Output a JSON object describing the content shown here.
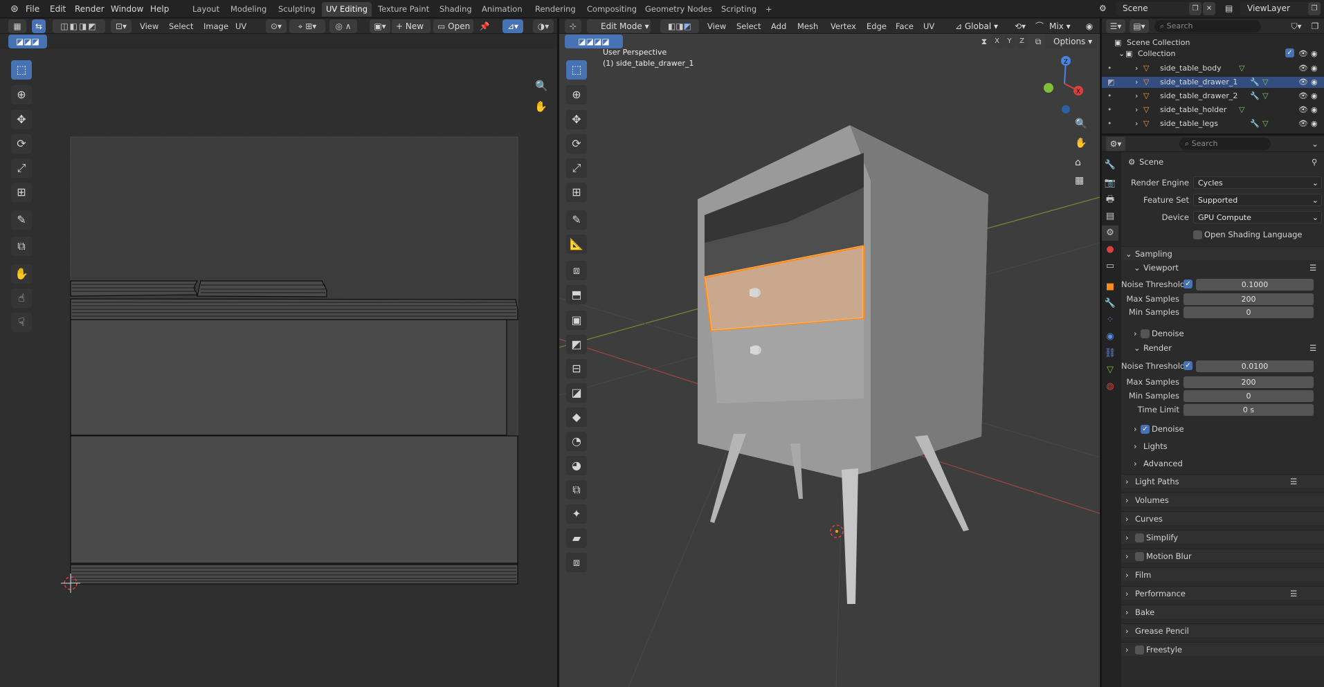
{
  "menu": {
    "file": "File",
    "edit": "Edit",
    "render": "Render",
    "window": "Window",
    "help": "Help",
    "workspaces": [
      {
        "label": "Layout"
      },
      {
        "label": "Modeling"
      },
      {
        "label": "Sculpting"
      },
      {
        "label": "UV Editing",
        "active": true
      },
      {
        "label": "Texture Paint"
      },
      {
        "label": "Shading"
      },
      {
        "label": "Animation"
      },
      {
        "label": "Rendering"
      },
      {
        "label": "Compositing"
      },
      {
        "label": "Geometry Nodes"
      },
      {
        "label": "Scripting"
      }
    ],
    "add_workspace": "+",
    "scene_name": "Scene",
    "view_layer": "ViewLayer"
  },
  "uv_editor": {
    "menus": {
      "view": "View",
      "select": "Select",
      "image": "Image",
      "uv": "UV"
    },
    "new_label": "New",
    "open_label": "Open"
  },
  "viewport": {
    "mode": "Edit Mode",
    "menus": {
      "view": "View",
      "select": "Select",
      "add": "Add",
      "mesh": "Mesh",
      "vertex": "Vertex",
      "edge": "Edge",
      "face": "Face",
      "uv": "UV"
    },
    "orientation": "Global",
    "proportional": "Mix",
    "axis_x": "X",
    "axis_y": "Y",
    "axis_z": "Z",
    "options_label": "Options",
    "overlay_title": "User Perspective",
    "overlay_object": "(1) side_table_drawer_1",
    "gizmo": {
      "x": "X",
      "y": "Y",
      "z": "Z"
    }
  },
  "outliner": {
    "search_placeholder": "Search",
    "scene_collection": "Scene Collection",
    "collection": "Collection",
    "items": [
      {
        "name": "side_table_body",
        "selected": false,
        "modifier": false
      },
      {
        "name": "side_table_drawer_1",
        "selected": true,
        "modifier": true
      },
      {
        "name": "side_table_drawer_2",
        "selected": false,
        "modifier": true
      },
      {
        "name": "side_table_holder",
        "selected": false,
        "modifier": false
      },
      {
        "name": "side_table_legs",
        "selected": false,
        "modifier": true
      }
    ]
  },
  "properties": {
    "search_placeholder": "Search",
    "context_title": "Scene",
    "render_engine_label": "Render Engine",
    "render_engine": "Cycles",
    "feature_set_label": "Feature Set",
    "feature_set": "Supported",
    "device_label": "Device",
    "device": "GPU Compute",
    "osl_label": "Open Shading Language",
    "sampling": "Sampling",
    "viewport": "Viewport",
    "noise_threshold_label": "Noise Threshold",
    "viewport_noise_threshold": "0.1000",
    "max_samples_label": "Max Samples",
    "viewport_max_samples": "200",
    "min_samples_label": "Min Samples",
    "viewport_min_samples": "0",
    "denoise_label": "Denoise",
    "render": "Render",
    "render_noise_threshold": "0.0100",
    "render_max_samples": "200",
    "render_min_samples": "0",
    "time_limit_label": "Time Limit",
    "render_time_limit": "0 s",
    "lights": "Lights",
    "advanced": "Advanced",
    "panels": [
      "Light Paths",
      "Volumes",
      "Curves",
      "Simplify",
      "Motion Blur",
      "Film",
      "Performance",
      "Bake",
      "Grease Pencil",
      "Freestyle"
    ]
  },
  "colors": {
    "accent": "#4772b3",
    "selection": "#ff8a1e",
    "header": "#2b2b2b",
    "viewport_bg": "#3d3d3d"
  }
}
